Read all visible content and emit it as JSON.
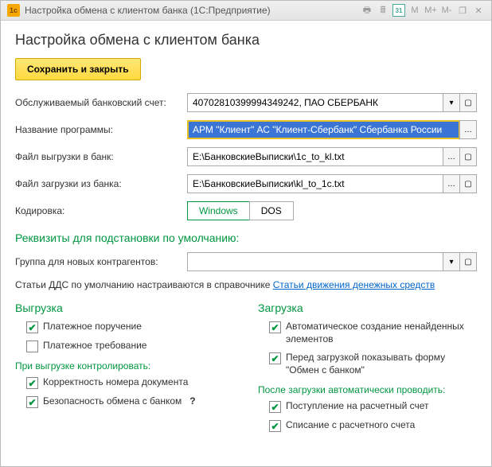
{
  "titlebar": {
    "logo": "1c",
    "title": "Настройка обмена с клиентом банка (1С:Предприятие)",
    "cal": "31",
    "m1": "M",
    "m2": "M+",
    "m3": "M-"
  },
  "header": "Настройка обмена с клиентом банка",
  "save_btn": "Сохранить и закрыть",
  "rows": {
    "account_label": "Обслуживаемый банковский счет:",
    "account_value": "40702810399994349242, ПАО СБЕРБАНК",
    "program_label": "Название программы:",
    "program_value": "АРМ \"Клиент\" АС \"Клиент-Сбербанк\" Сбербанка России",
    "export_label": "Файл выгрузки в банк:",
    "export_value": "E:\\БанковскиеВыписки\\1c_to_kl.txt",
    "import_label": "Файл загрузки из банка:",
    "import_value": "E:\\БанковскиеВыписки\\kl_to_1c.txt",
    "encoding_label": "Кодировка:",
    "enc_win": "Windows",
    "enc_dos": "DOS"
  },
  "defaults_title": "Реквизиты для подстановки по умолчанию:",
  "group_label": "Группа для новых контрагентов:",
  "group_value": "",
  "dds_text": "Статьи ДДС по умолчанию настраиваются в справочнике",
  "dds_link": "Статьи движения денежных средств",
  "export": {
    "title": "Выгрузка",
    "c1": "Платежное поручение",
    "c2": "Платежное требование",
    "control_title": "При выгрузке контролировать:",
    "c3": "Корректность номера документа",
    "c4": "Безопасность обмена с банком"
  },
  "import": {
    "title": "Загрузка",
    "c1": "Автоматическое создание ненайденных элементов",
    "c2": "Перед загрузкой показывать форму \"Обмен с банком\"",
    "auto_title": "После загрузки автоматически проводить:",
    "c3": "Поступление на расчетный счет",
    "c4": "Списание с расчетного счета"
  }
}
